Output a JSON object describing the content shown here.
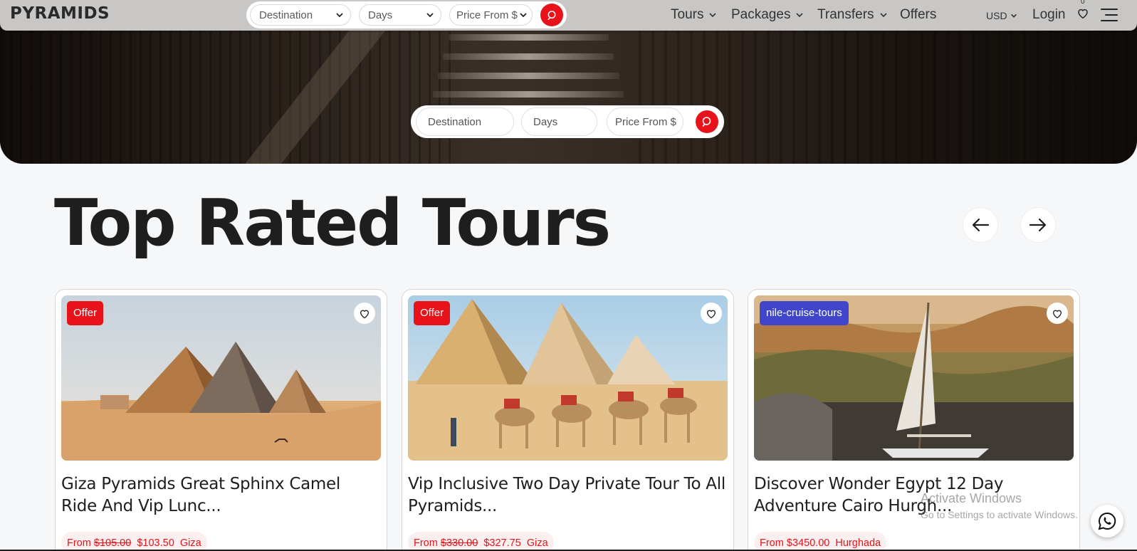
{
  "brand": {
    "logo": "PYRAMIDS",
    "accent": "#e8131a",
    "badge_blue": "#4046c9"
  },
  "nav_search": {
    "destination": "Destination",
    "days": "Days",
    "price": "Price From $"
  },
  "menu": [
    {
      "label": "Tours"
    },
    {
      "label": "Packages"
    },
    {
      "label": "Transfers"
    },
    {
      "label": "Offers"
    }
  ],
  "currency": "USD",
  "login": "Login",
  "wishlist_count": "0",
  "hero_search": {
    "destination": "Destination",
    "days": "Days",
    "price": "Price From $"
  },
  "section": {
    "title": "Top Rated Tours"
  },
  "cards": [
    {
      "badge": "Offer",
      "title_line1": "Giza Pyramids Great Sphinx Camel",
      "title_line2": "Ride And Vip Lunc...",
      "from": "From",
      "old_price": "$105.00",
      "price": "$103.50",
      "location": "Giza"
    },
    {
      "badge": "Offer",
      "title_line1": "Vip Inclusive Two Day Private Tour To All",
      "title_line2": "Pyramids...",
      "from": "From",
      "old_price": "$330.00",
      "price": "$327.75",
      "location": "Giza"
    },
    {
      "badge": "nile-cruise-tours",
      "title_line1": "Discover Wonder Egypt 12 Day",
      "title_line2": "Adventure Cairo Hurgh...",
      "from": "From",
      "price": "$3450.00",
      "location": "Hurghada"
    }
  ],
  "watermark": {
    "line1": "Activate Windows",
    "line2": "Go to Settings to activate Windows."
  },
  "icons": [
    "search-icon",
    "chevron-down-icon",
    "heart-icon",
    "menu-icon",
    "arrow-left-icon",
    "arrow-right-icon",
    "whatsapp-icon"
  ]
}
